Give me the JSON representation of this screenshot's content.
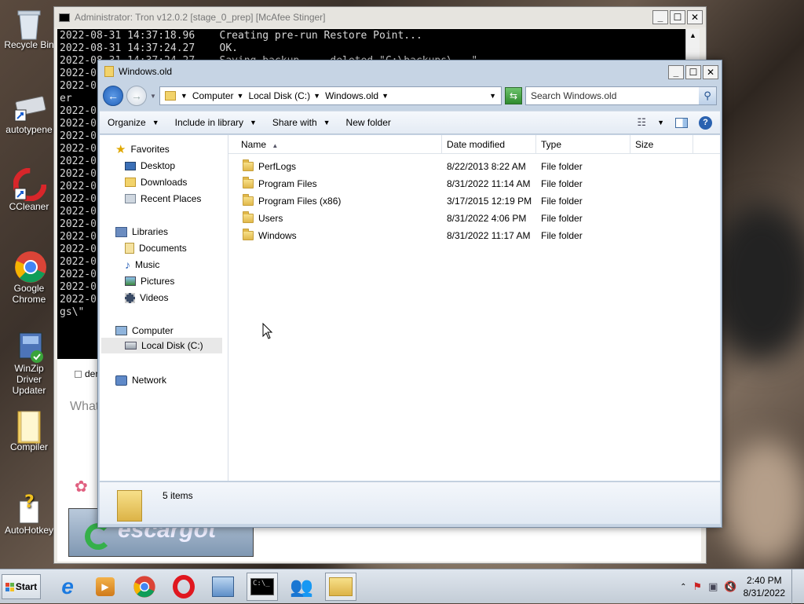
{
  "desktop": {
    "icons": [
      {
        "label": "Recycle Bin",
        "icon": "recycle-bin-icon"
      },
      {
        "label": "autotypene",
        "icon": "keyboard-icon"
      },
      {
        "label": "CCleaner",
        "icon": "ccleaner-icon"
      },
      {
        "label": "Google Chrome",
        "icon": "chrome-icon"
      },
      {
        "label": "WinZip Driver Updater",
        "icon": "winzip-icon"
      },
      {
        "label": "Compiler",
        "icon": "folder-icon"
      },
      {
        "label": "AutoHotkey",
        "icon": "autohotkey-icon"
      }
    ]
  },
  "console": {
    "title": "Administrator:  Tron v12.0.2 [stage_0_prep] [McAfee Stinger]",
    "lines": [
      "2022-08-31 14:37:18.96    Creating pre-run Restore Point...",
      "2022-08-31 14:37:24.27    OK.",
      "2022-08-31 14:37:24.27    Saving backup...  deleted \"C:\\backups\\...\"",
      "2022-0",
      "2022-0",
      "er",
      "2022-0",
      "2022-0",
      "2022-0",
      "2022-0",
      "2022-0",
      "2022-0",
      "2022-0",
      "2022-0",
      "2022-0",
      "2022-0",
      "2022-0",
      "2022-0",
      "2022-0",
      "2022-0",
      "2022-0",
      "2022-0",
      "gs\\\""
    ],
    "lower_checkbox": "der",
    "lower_text": "What",
    "lower_logo": "escargot"
  },
  "explorer": {
    "title": "Windows.old",
    "breadcrumb": [
      "Computer",
      "Local Disk (C:)",
      "Windows.old"
    ],
    "search_placeholder": "Search Windows.old",
    "toolbar": {
      "organize": "Organize",
      "include_in_library": "Include in library",
      "share_with": "Share with",
      "new_folder": "New folder"
    },
    "nav": {
      "favorites": "Favorites",
      "desktop": "Desktop",
      "downloads": "Downloads",
      "recent_places": "Recent Places",
      "libraries": "Libraries",
      "documents": "Documents",
      "music": "Music",
      "pictures": "Pictures",
      "videos": "Videos",
      "computer": "Computer",
      "local_disk": "Local Disk (C:)",
      "network": "Network"
    },
    "columns": {
      "name": "Name",
      "date_modified": "Date modified",
      "type": "Type",
      "size": "Size"
    },
    "files": [
      {
        "name": "PerfLogs",
        "date": "8/22/2013 8:22 AM",
        "type": "File folder"
      },
      {
        "name": "Program Files",
        "date": "8/31/2022 11:14 AM",
        "type": "File folder"
      },
      {
        "name": "Program Files (x86)",
        "date": "3/17/2015 12:19 PM",
        "type": "File folder"
      },
      {
        "name": "Users",
        "date": "8/31/2022 4:06 PM",
        "type": "File folder"
      },
      {
        "name": "Windows",
        "date": "8/31/2022 11:17 AM",
        "type": "File folder"
      }
    ],
    "item_count": "5 items"
  },
  "taskbar": {
    "start_label": "Start",
    "apps": [
      "ie-icon",
      "media-player-icon",
      "chrome-icon",
      "opera-icon",
      "network-tool-icon",
      "cmd-icon",
      "users-icon",
      "explorer-icon"
    ],
    "clock_time": "2:40 PM",
    "clock_date": "8/31/2022"
  }
}
